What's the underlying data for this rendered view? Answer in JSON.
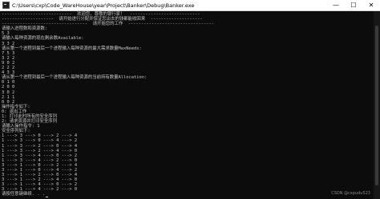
{
  "window": {
    "title": "C:\\Users\\cxp\\Code_WareHouse\\year\\Project\\Banker\\Debug\\Banker.exe",
    "minimize_symbol": "—",
    "maximize_symbol": "☐",
    "close_symbol": "✕"
  },
  "console": {
    "lines": [
      "---------------------------  欢迎您，尊敬的银行家！  ---------------------------",
      "--------------------  请开始进行分配并保证您出去的钱都能收回来  --------------------",
      "---------------------------------  请开始您的工作  ---------------------------------",
      "请输入进程数和资源数:",
      "5 3",
      "请输入每种资源的现在剩余数Available:",
      "3 3 2",
      "请从第一个进程到最后一个进程输入每种资源的最大需求数量MaxNeeds:",
      "7 5 3",
      "3 2 2",
      "9 0 2",
      "2 2 2",
      "4 3 3",
      "请从第一个进程到最后一个进程输入每种资源的当前持有数量Allocation:",
      "0 1 0",
      "2 0 0",
      "3 0 2",
      "2 1 1",
      "0 0 2",
      "操作指令如下:",
      "0: 退出工作",
      "1: 打印此时所有的安全序列",
      "2: 请求资源并打印安全序列",
      "请输入操作指令: 1",
      "安全序列如下:",
      "1 ---> 3 ---> 0 ---> 2 ---> 4",
      "1 ---> 3 ---> 0 ---> 4 ---> 2",
      "1 ---> 3 ---> 2 ---> 0 ---> 4",
      "1 ---> 3 ---> 2 ---> 4 ---> 0",
      "1 ---> 3 ---> 4 ---> 0 ---> 2",
      "1 ---> 3 ---> 4 ---> 2 ---> 0",
      "3 ---> 1 ---> 0 ---> 2 ---> 4",
      "3 ---> 1 ---> 0 ---> 4 ---> 2",
      "3 ---> 1 ---> 2 ---> 0 ---> 4",
      "3 ---> 1 ---> 2 ---> 4 ---> 0",
      "3 ---> 1 ---> 4 ---> 0 ---> 2",
      "3 ---> 1 ---> 4 ---> 2 ---> 0",
      "请按任意键继续. . ."
    ]
  },
  "watermark": "CSDN @cxpudu523"
}
